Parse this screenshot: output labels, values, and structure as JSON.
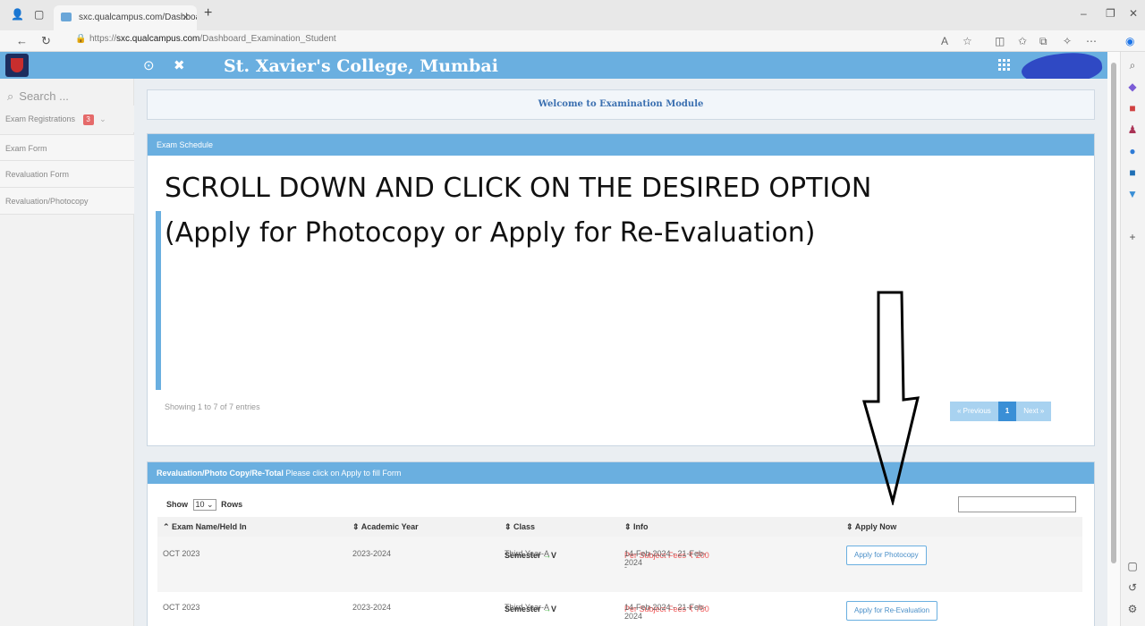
{
  "browser": {
    "tab_title": "sxc.qualcampus.com/Dashboard",
    "url_prefix": "https://",
    "url_host": "sxc.qualcampus.com",
    "url_path": "/Dashboard_Examination_Student"
  },
  "header": {
    "college_name": "St. Xavier's College, Mumbai"
  },
  "sidebar": {
    "search_placeholder": "Search ...",
    "items": [
      {
        "label": "Exam Registrations",
        "badge": "3"
      },
      {
        "label": "Exam Form"
      },
      {
        "label": "Revaluation Form"
      },
      {
        "label": "Revaluation/Photocopy"
      }
    ]
  },
  "main": {
    "welcome": "Welcome to Examination Module",
    "schedule_title": "Exam Schedule",
    "overlay_line1": "SCROLL DOWN AND CLICK ON THE DESIRED OPTION",
    "overlay_line2": "(Apply for Photocopy or Apply for Re-Evaluation)",
    "showing": "Showing 1 to 7 of 7 entries",
    "pager": {
      "prev": "« Previous",
      "current": "1",
      "next": "Next »"
    },
    "reval_title_bold": "Revaluation/Photo Copy/Re-Total",
    "reval_title_rest": "Please click on Apply to fill Form",
    "show_label": "Show",
    "show_value": "10",
    "rows_label": "Rows",
    "columns": [
      "Exam Name/Held In",
      "Academic Year",
      "Class",
      "Info",
      "Apply Now"
    ],
    "rows": [
      {
        "exam": "OCT 2023",
        "year": "2023-2024",
        "class": "Third Year-A",
        "semester": "Semester",
        "sem_num": "V",
        "dates": "14-Feb-2024 - 21-Feb-2024",
        "fees": "Per Subject Fees ₹ 200",
        "dash": "-",
        "button": "Apply for Photocopy"
      },
      {
        "exam": "OCT 2023",
        "year": "2023-2024",
        "class": "Third Year-A",
        "semester": "Semester",
        "sem_num": "V",
        "dates": "14-Feb-2024 - 21-Feb-2024",
        "fees": "Per Subject Fees ₹ 750",
        "button": "Apply for Re-Evaluation"
      }
    ]
  }
}
